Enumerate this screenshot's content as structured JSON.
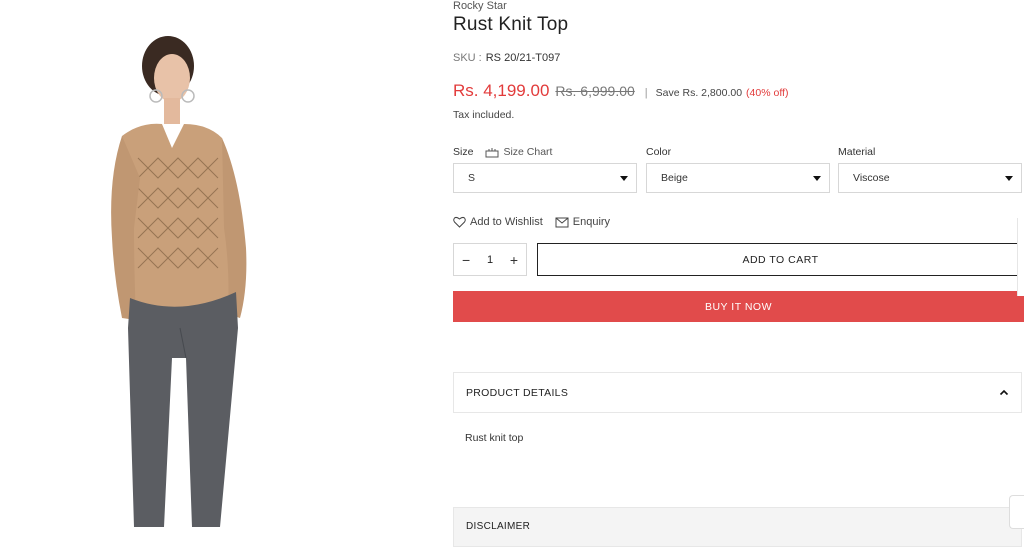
{
  "product": {
    "vendor": "Rocky Star",
    "title": "Rust Knit Top",
    "sku_label": "SKU :",
    "sku": "RS 20/21-T097",
    "price": "Rs. 4,199.00",
    "compare_price": "Rs. 6,999.00",
    "separator": "|",
    "save": "Save Rs. 2,800.00",
    "discount": "(40% off)",
    "tax_note": "Tax included."
  },
  "options": {
    "size": {
      "label": "Size",
      "value": "S",
      "size_chart": "Size Chart"
    },
    "color": {
      "label": "Color",
      "value": "Beige"
    },
    "material": {
      "label": "Material",
      "value": "Viscose"
    }
  },
  "actions": {
    "wishlist": "Add to Wishlist",
    "enquiry": "Enquiry",
    "qty_minus": "−",
    "qty_value": "1",
    "qty_plus": "+",
    "add_to_cart": "ADD TO CART",
    "buy_now": "BUY IT NOW"
  },
  "accordion": {
    "details_title": "PRODUCT DETAILS",
    "details_body": "Rust knit top",
    "disclaimer_title": "DISCLAIMER"
  },
  "colors": {
    "accent_red": "#e23b3b",
    "buy_button": "#e14b4b"
  }
}
